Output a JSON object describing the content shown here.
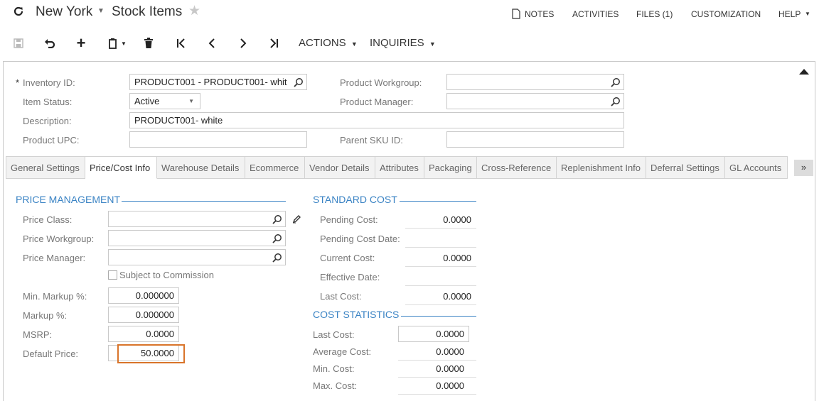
{
  "header": {
    "company": "New York",
    "screen_title": "Stock Items",
    "links": {
      "notes": "NOTES",
      "activities": "ACTIVITIES",
      "files": "FILES (1)",
      "customization": "CUSTOMIZATION",
      "help": "HELP"
    }
  },
  "toolbar": {
    "actions": "ACTIONS",
    "inquiries": "INQUIRIES"
  },
  "form": {
    "inventory_id_label": "Inventory ID:",
    "inventory_id_value": "PRODUCT001 - PRODUCT001- whit",
    "item_status_label": "Item Status:",
    "item_status_value": "Active",
    "description_label": "Description:",
    "description_value": "PRODUCT001- white",
    "product_upc_label": "Product UPC:",
    "product_upc_value": "",
    "product_workgroup_label": "Product Workgroup:",
    "product_workgroup_value": "",
    "product_manager_label": "Product Manager:",
    "product_manager_value": "",
    "parent_sku_label": "Parent SKU ID:",
    "parent_sku_value": ""
  },
  "tabs": [
    "General Settings",
    "Price/Cost Info",
    "Warehouse Details",
    "Ecommerce",
    "Vendor Details",
    "Attributes",
    "Packaging",
    "Cross-Reference",
    "Replenishment Info",
    "Deferral Settings",
    "GL Accounts"
  ],
  "price_management": {
    "title": "PRICE MANAGEMENT",
    "price_class_label": "Price Class:",
    "price_class_value": "",
    "price_workgroup_label": "Price Workgroup:",
    "price_workgroup_value": "",
    "price_manager_label": "Price Manager:",
    "price_manager_value": "",
    "subject_to_commission": "Subject to Commission",
    "min_markup_label": "Min. Markup %:",
    "min_markup_value": "0.000000",
    "markup_label": "Markup %:",
    "markup_value": "0.000000",
    "msrp_label": "MSRP:",
    "msrp_value": "0.0000",
    "default_price_label": "Default Price:",
    "default_price_value": "50.0000"
  },
  "standard_cost": {
    "title": "STANDARD COST",
    "pending_cost_label": "Pending Cost:",
    "pending_cost_value": "0.0000",
    "pending_cost_date_label": "Pending Cost Date:",
    "pending_cost_date_value": "",
    "current_cost_label": "Current Cost:",
    "current_cost_value": "0.0000",
    "effective_date_label": "Effective Date:",
    "effective_date_value": "",
    "last_cost_label": "Last Cost:",
    "last_cost_value": "0.0000"
  },
  "cost_statistics": {
    "title": "COST STATISTICS",
    "last_cost_label": "Last Cost:",
    "last_cost_value": "0.0000",
    "average_cost_label": "Average Cost:",
    "average_cost_value": "0.0000",
    "min_cost_label": "Min. Cost:",
    "min_cost_value": "0.0000",
    "max_cost_label": "Max. Cost:",
    "max_cost_value": "0.0000"
  },
  "colors": {
    "accent": "#3a83c4",
    "highlight": "#d9742a"
  }
}
